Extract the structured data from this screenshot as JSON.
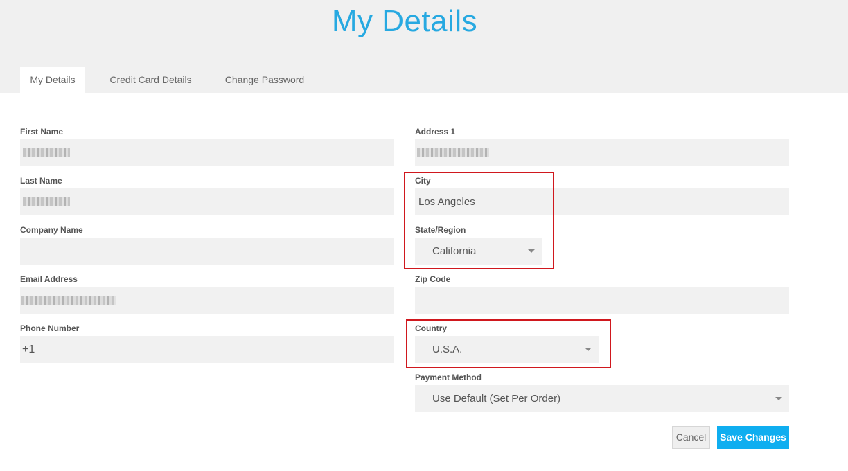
{
  "page": {
    "title": "My Details"
  },
  "tabs": [
    {
      "label": "My Details",
      "active": true
    },
    {
      "label": "Credit Card Details",
      "active": false
    },
    {
      "label": "Change Password",
      "active": false
    }
  ],
  "left_fields": {
    "first_name": {
      "label": "First Name",
      "value": ""
    },
    "last_name": {
      "label": "Last Name",
      "value": ""
    },
    "company_name": {
      "label": "Company Name",
      "value": ""
    },
    "email": {
      "label": "Email Address",
      "value": ""
    },
    "phone": {
      "label": "Phone Number",
      "value": "+1"
    }
  },
  "right_fields": {
    "address1": {
      "label": "Address 1",
      "value": ""
    },
    "city": {
      "label": "City",
      "value": "Los Angeles"
    },
    "state": {
      "label": "State/Region",
      "value": "California"
    },
    "zip": {
      "label": "Zip Code",
      "value": ""
    },
    "country": {
      "label": "Country",
      "value": "U.S.A."
    },
    "payment_method": {
      "label": "Payment Method",
      "value": "Use Default (Set Per Order)"
    }
  },
  "actions": {
    "cancel_label": "Cancel",
    "save_label": "Save Changes"
  },
  "colors": {
    "accent": "#27a9e1",
    "save_button": "#0faef0",
    "highlight": "#d0181e",
    "field_bg": "#f1f1f1",
    "header_bg": "#f0f0f0"
  },
  "icons": {
    "select_caret": "caret-down-icon"
  }
}
